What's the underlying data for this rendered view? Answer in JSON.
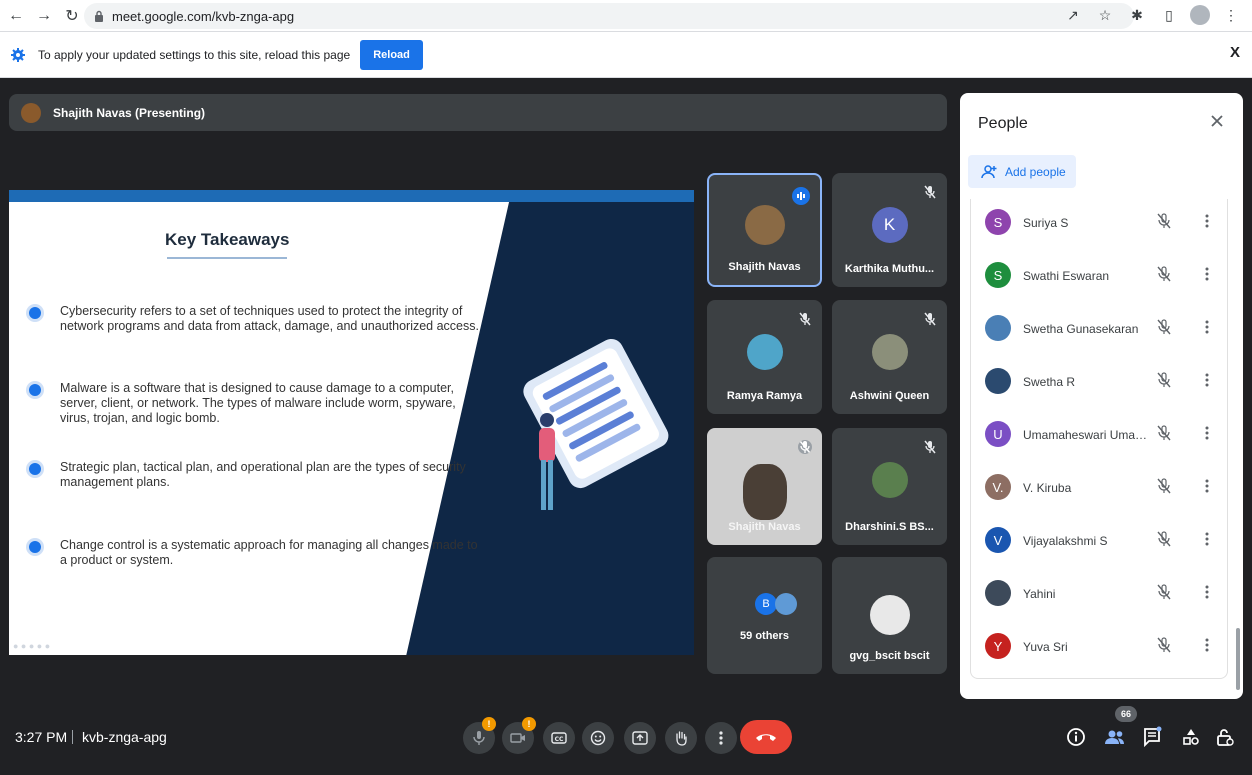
{
  "browser": {
    "url": "meet.google.com/kvb-znga-apg"
  },
  "infobar": {
    "message": "To apply your updated settings to this site, reload this page",
    "reload_label": "Reload",
    "close_label": "X"
  },
  "presenter": {
    "label": "Shajith Navas (Presenting)"
  },
  "slide": {
    "title": "Key Takeaways",
    "bullets": [
      "Cybersecurity refers to a set of techniques used to protect the integrity of network programs and data from attack, damage, and unauthorized access.",
      "Malware is a software that is designed to cause damage to a computer, server, client, or network. The types of malware include worm, spyware, virus, trojan, and logic bomb.",
      "Strategic plan, tactical plan, and operational plan are the types of security management plans.",
      "Change control is a systematic approach for managing all changes made to a product or system."
    ]
  },
  "tiles": [
    {
      "name": "Shajith Navas",
      "state": "speaking"
    },
    {
      "name": "Karthika Muthu...",
      "initial": "K",
      "color": "#5c6bc0",
      "state": "muted"
    },
    {
      "name": "Ramya Ramya",
      "state": "muted"
    },
    {
      "name": "Ashwini Queen",
      "state": "muted"
    },
    {
      "name": "Shajith Navas",
      "state": "video"
    },
    {
      "name": "Dharshini.S BS...",
      "state": "muted"
    },
    {
      "name": "59 others",
      "initial": "B"
    },
    {
      "name": "gvg_bscit bscit"
    }
  ],
  "people": {
    "title": "People",
    "add_label": "Add people",
    "list": [
      {
        "name": "Suriya S",
        "initial": "S",
        "color": "#8e44ad"
      },
      {
        "name": "Swathi Eswaran",
        "initial": "S",
        "color": "#1e8e3e"
      },
      {
        "name": "Swetha Gunasekaran",
        "initial": "",
        "color": "#4a7fb5"
      },
      {
        "name": "Swetha R",
        "initial": "",
        "color": "#2b4a6f"
      },
      {
        "name": "Umamaheswari Umama...",
        "initial": "U",
        "color": "#7b4fc4"
      },
      {
        "name": "V. Kiruba",
        "initial": "V.",
        "color": "#8d6e63"
      },
      {
        "name": "Vijayalakshmi S",
        "initial": "V",
        "color": "#1a56b0"
      },
      {
        "name": "Yahini",
        "initial": "",
        "color": "#3d4a5a"
      },
      {
        "name": "Yuva Sri",
        "initial": "Y",
        "color": "#c5221f"
      }
    ]
  },
  "bottom": {
    "time": "3:27 PM",
    "code": "kvb-znga-apg",
    "participant_count": "66",
    "alert_badge": "!"
  },
  "colors": {
    "accent": "#1a73e8",
    "end_call": "#ea4335",
    "warning": "#f29900"
  }
}
